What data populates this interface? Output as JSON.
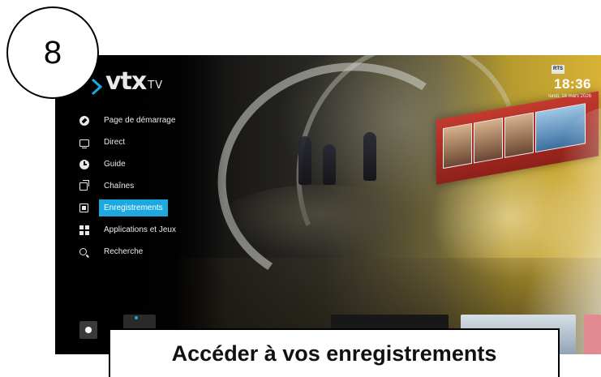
{
  "step": {
    "number": "8"
  },
  "logo": {
    "main": "vtx",
    "suffix": "TV"
  },
  "menu": {
    "items": [
      {
        "label": "Page de démarrage",
        "icon": "compass-icon",
        "active": false
      },
      {
        "label": "Direct",
        "icon": "tv-icon",
        "active": false
      },
      {
        "label": "Guide",
        "icon": "clock-icon",
        "active": false
      },
      {
        "label": "Chaînes",
        "icon": "channels-icon",
        "active": false
      },
      {
        "label": "Enregistrements",
        "icon": "recordings-icon",
        "active": true
      },
      {
        "label": "Applications et Jeux",
        "icon": "apps-grid-icon",
        "active": false
      },
      {
        "label": "Recherche",
        "icon": "search-icon",
        "active": false
      }
    ]
  },
  "status": {
    "channel_badge": "RTS",
    "time": "18:36",
    "date": "lundi, 16 mars 2026"
  },
  "caption": {
    "text": "Accéder à vos enregistrements"
  },
  "colors": {
    "accent": "#1ea8e0"
  }
}
